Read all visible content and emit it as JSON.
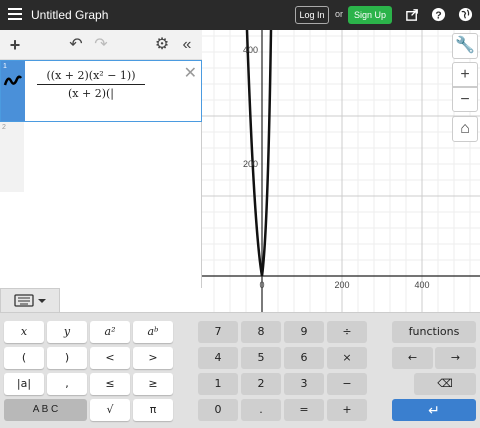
{
  "topbar": {
    "title": "Untitled Graph",
    "login_label": "Log In",
    "or_label": "or",
    "signup_label": "Sign Up",
    "signup_color": "#2bb34a",
    "icons": [
      "share-icon",
      "help-icon",
      "globe-icon"
    ]
  },
  "expression_list": {
    "rows": [
      {
        "index": "1",
        "numerator": "((x + 2)(x² − 1))",
        "denominator": "(x + 2)(|"
      },
      {
        "index": "2"
      }
    ]
  },
  "graph": {
    "x_ticks": [
      "0",
      "200",
      "400"
    ],
    "y_ticks": [
      "200",
      "400"
    ]
  },
  "keyboard": {
    "row1": [
      "x",
      "y",
      "a²",
      "aᵇ",
      "7",
      "8",
      "9",
      "÷",
      "functions"
    ],
    "row2": [
      "(",
      ")",
      "<",
      ">",
      "4",
      "5",
      "6",
      "×",
      "←",
      "→"
    ],
    "row3": [
      "|a|",
      ",",
      "≤",
      "≥",
      "1",
      "2",
      "3",
      "−",
      "⌫"
    ],
    "row4": [
      "A B C",
      "√",
      "π",
      "0",
      ".",
      "=",
      "+",
      "↵"
    ]
  }
}
